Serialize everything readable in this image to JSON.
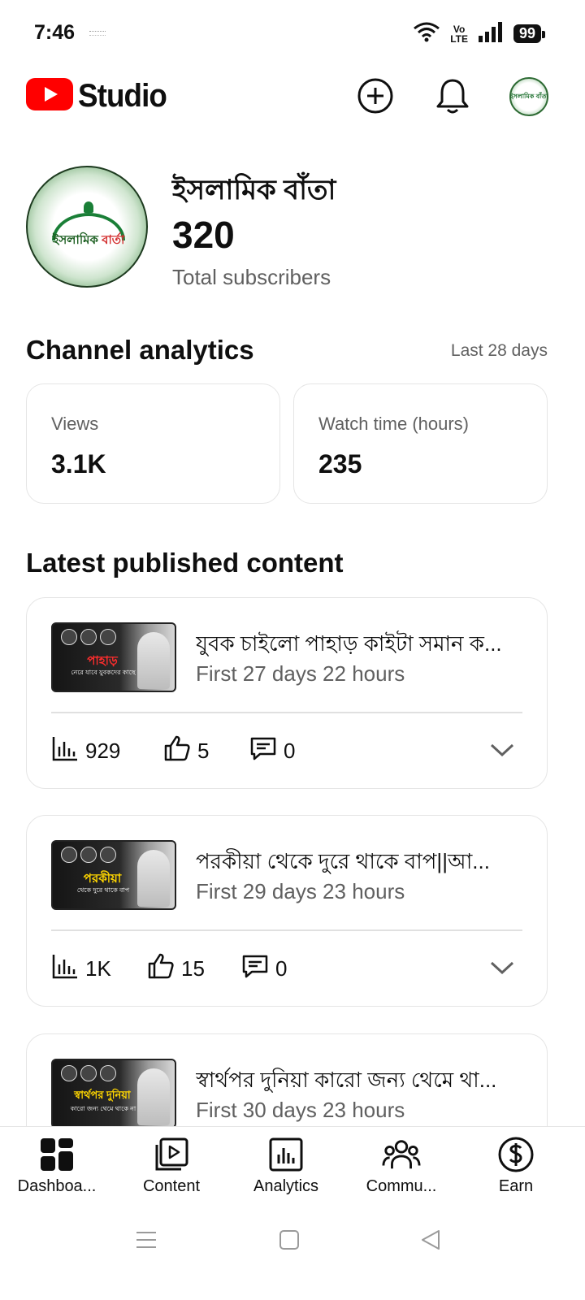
{
  "status_bar": {
    "time": "7:46",
    "volte_top": "Vo",
    "volte_bottom": "LTE",
    "battery": "99"
  },
  "header": {
    "app_name": "Studio",
    "brand_color": "#ff0000",
    "icons": [
      "create-icon",
      "notifications-icon",
      "account-avatar"
    ],
    "avatar_label": "ইসলামিক বাঁতা"
  },
  "channel": {
    "name": "ইসলামিক বাঁতা",
    "subscriber_count": "320",
    "subscriber_label": "Total subscribers",
    "avatar_text_a": "ইসলামিক",
    "avatar_text_b": "বার্তা"
  },
  "analytics": {
    "title": "Channel analytics",
    "range": "Last 28 days",
    "metrics": [
      {
        "label": "Views",
        "value": "3.1K"
      },
      {
        "label": "Watch time (hours)",
        "value": "235"
      }
    ]
  },
  "latest": {
    "title": "Latest published content",
    "videos": [
      {
        "title": "যুবক চাইলো পাহাড় কাইটা সমান ক...",
        "time": "First 27 days 22 hours",
        "views": "929",
        "likes": "5",
        "comments": "0",
        "thumb_title": "পাহাড়",
        "thumb_title_color": "#ff2d2d",
        "thumb_sub": "নেরে যাবে যুবকদের কাছে"
      },
      {
        "title": "পরকীয়া থেকে দুরে থাকে বাপ||আ...",
        "time": "First 29 days 23 hours",
        "views": "1K",
        "likes": "15",
        "comments": "0",
        "thumb_title": "পরকীয়া",
        "thumb_title_color": "#ffd600",
        "thumb_sub": "থেকে দুরে থাকে বাপ"
      },
      {
        "title": "স্বার্থপর দুনিয়া কারো জন্য থেমে থা...",
        "time": "First 30 days 23 hours",
        "thumb_title": "স্বার্থপর দুনিয়া",
        "thumb_title_color": "#ffd600",
        "thumb_sub": "কারো জন্য থেমে থাকে না"
      }
    ]
  },
  "bottom_nav": {
    "items": [
      {
        "label": "Dashboa...",
        "icon": "dashboard-icon"
      },
      {
        "label": "Content",
        "icon": "content-icon"
      },
      {
        "label": "Analytics",
        "icon": "analytics-icon"
      },
      {
        "label": "Commu...",
        "icon": "community-icon"
      },
      {
        "label": "Earn",
        "icon": "earn-icon"
      }
    ]
  },
  "system_nav": {
    "icons": [
      "menu-icon",
      "home-icon",
      "back-icon"
    ]
  }
}
